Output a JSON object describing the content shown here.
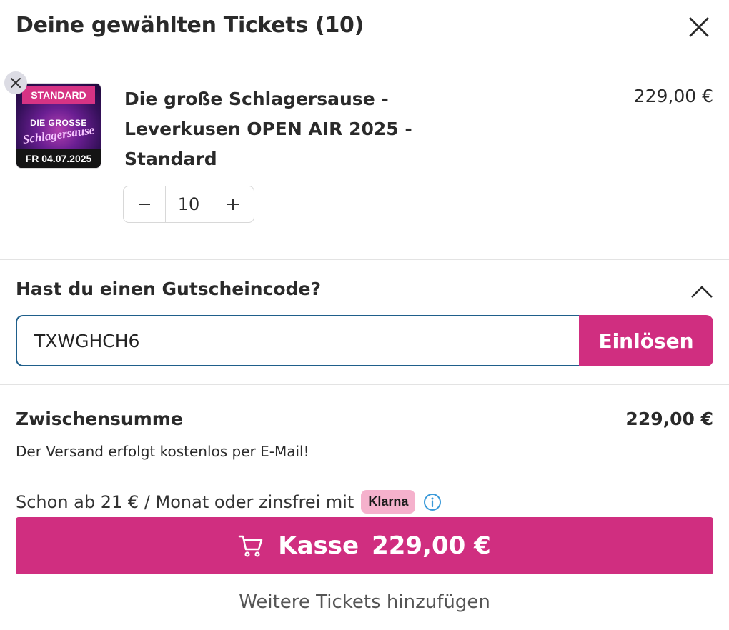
{
  "header": {
    "title": "Deine gewählten Tickets (10)"
  },
  "item": {
    "thumbnail": {
      "badge": "STANDARD",
      "logo_line1": "DIE GROSSE",
      "logo_line2": "Schlagersause",
      "date": "FR 04.07.2025"
    },
    "title": "Die große Schlagersause - Leverkusen OPEN AIR 2025 - Standard",
    "price": "229,00 €",
    "quantity": "10",
    "remove_icon": "close-icon",
    "decrement_icon": "minus-icon",
    "increment_icon": "plus-icon"
  },
  "voucher": {
    "title": "Hast du einen Gutscheincode?",
    "code": "TXWGHCH6",
    "redeem_label": "Einlösen",
    "toggle_icon": "chevron-up-icon"
  },
  "summary": {
    "subtotal_label": "Zwischensumme",
    "subtotal_value": "229,00 €",
    "shipping_note": "Der Versand erfolgt kostenlos per E-Mail!"
  },
  "klarna": {
    "text": "Schon ab 21 € / Monat oder zinsfrei mit",
    "brand": "Klarna"
  },
  "checkout": {
    "label": "Kasse",
    "price": "229,00 €",
    "icon": "cart-icon"
  },
  "more_link": "Weitere Tickets hinzufügen",
  "colors": {
    "accent": "#d02e80",
    "klarna_pink": "#f5b1cc",
    "input_border": "#1f5f8b",
    "info_blue": "#3a9ad9"
  }
}
